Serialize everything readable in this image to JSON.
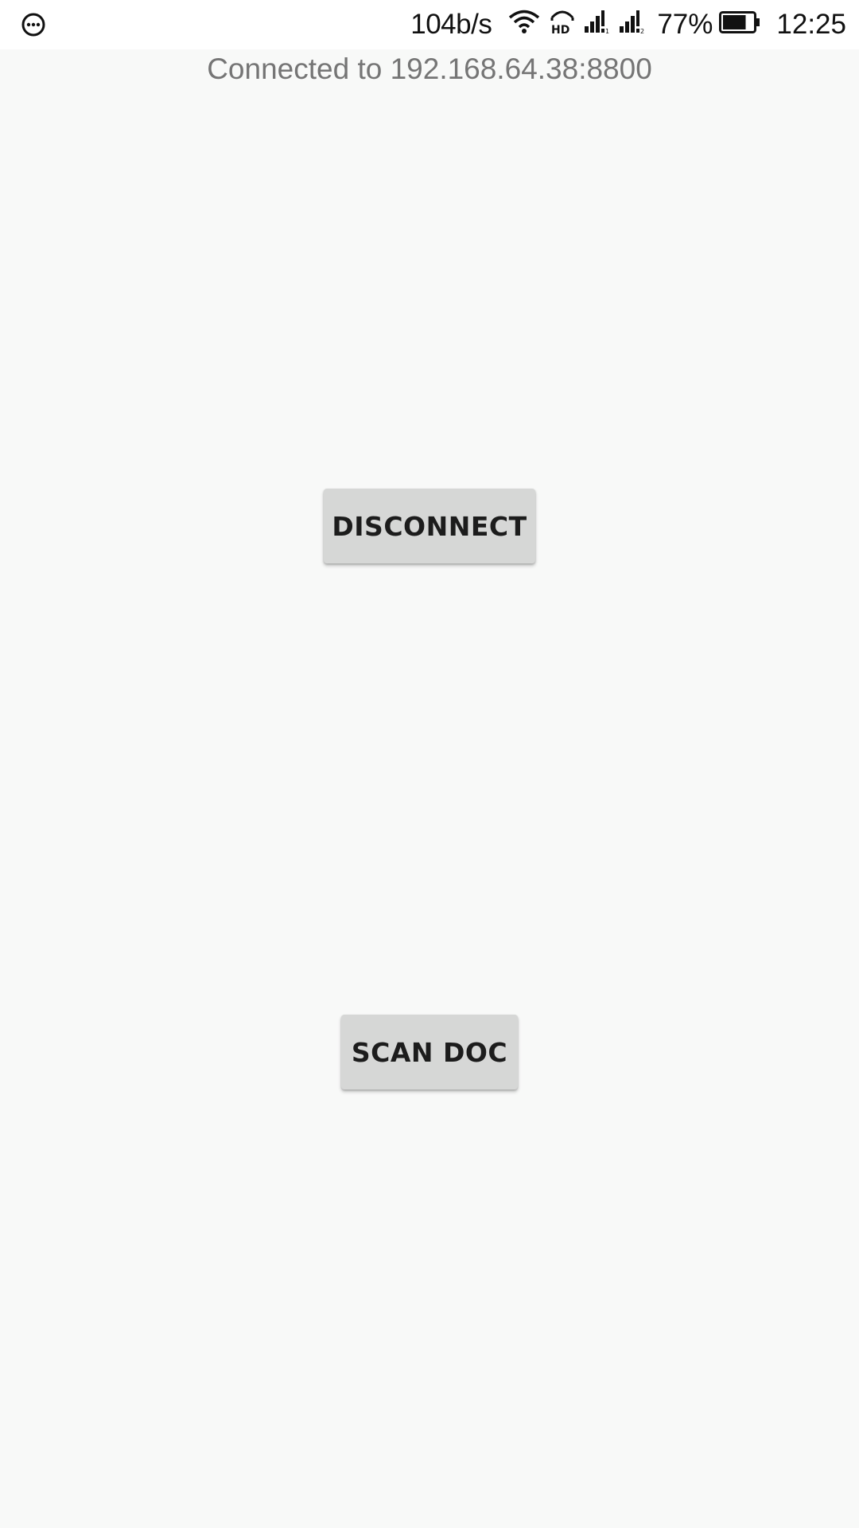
{
  "status_bar": {
    "network_speed": "104b/s",
    "battery_percent": "77%",
    "battery_level": 0.77,
    "time": "12:25",
    "icons": [
      "messaging-icon",
      "wifi-icon",
      "hd-voice-icon",
      "signal-1-icon",
      "signal-2-icon",
      "battery-icon"
    ]
  },
  "main": {
    "connection_status": "Connected to 192.168.64.38:8800",
    "disconnect_label": "DISCONNECT",
    "scan_doc_label": "SCAN DOC"
  },
  "colors": {
    "background": "#f8f9f8",
    "button": "#d6d7d6",
    "status_text": "#757575"
  }
}
